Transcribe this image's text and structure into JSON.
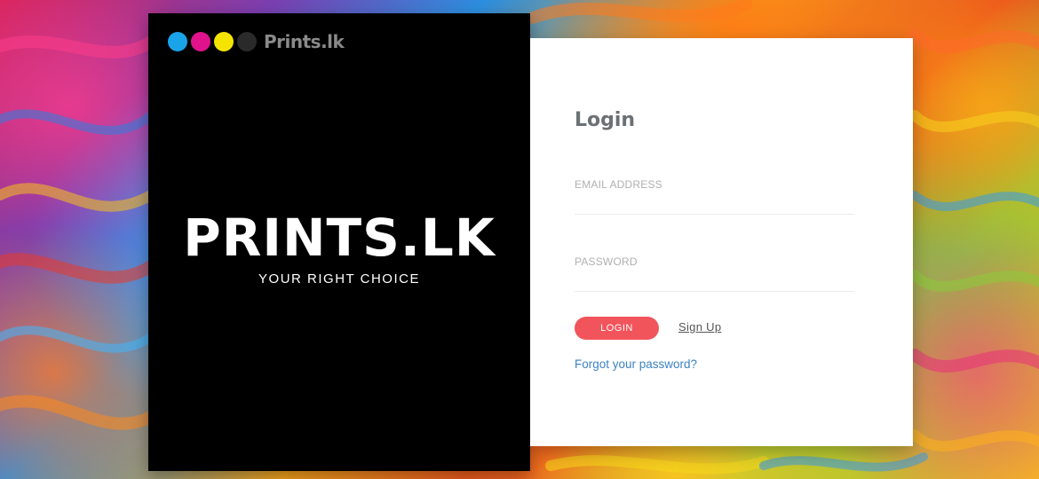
{
  "brand": {
    "logo_text": "Prints.lk",
    "logo_dot_colors": [
      "#1aa3e8",
      "#e0128c",
      "#f5e400",
      "#2a2a2a"
    ],
    "title": "PRINTS.LK",
    "tagline": "YOUR RIGHT CHOICE"
  },
  "login": {
    "heading": "Login",
    "email_label": "EMAIL ADDRESS",
    "email_value": "",
    "password_label": "PASSWORD",
    "password_value": "",
    "login_button": "LOGIN",
    "signup_link": "Sign Up",
    "forgot_link": "Forgot your password?"
  },
  "colors": {
    "accent": "#f2545b",
    "link": "#3b82c4",
    "panel_dark": "#000000",
    "panel_light": "#ffffff"
  }
}
